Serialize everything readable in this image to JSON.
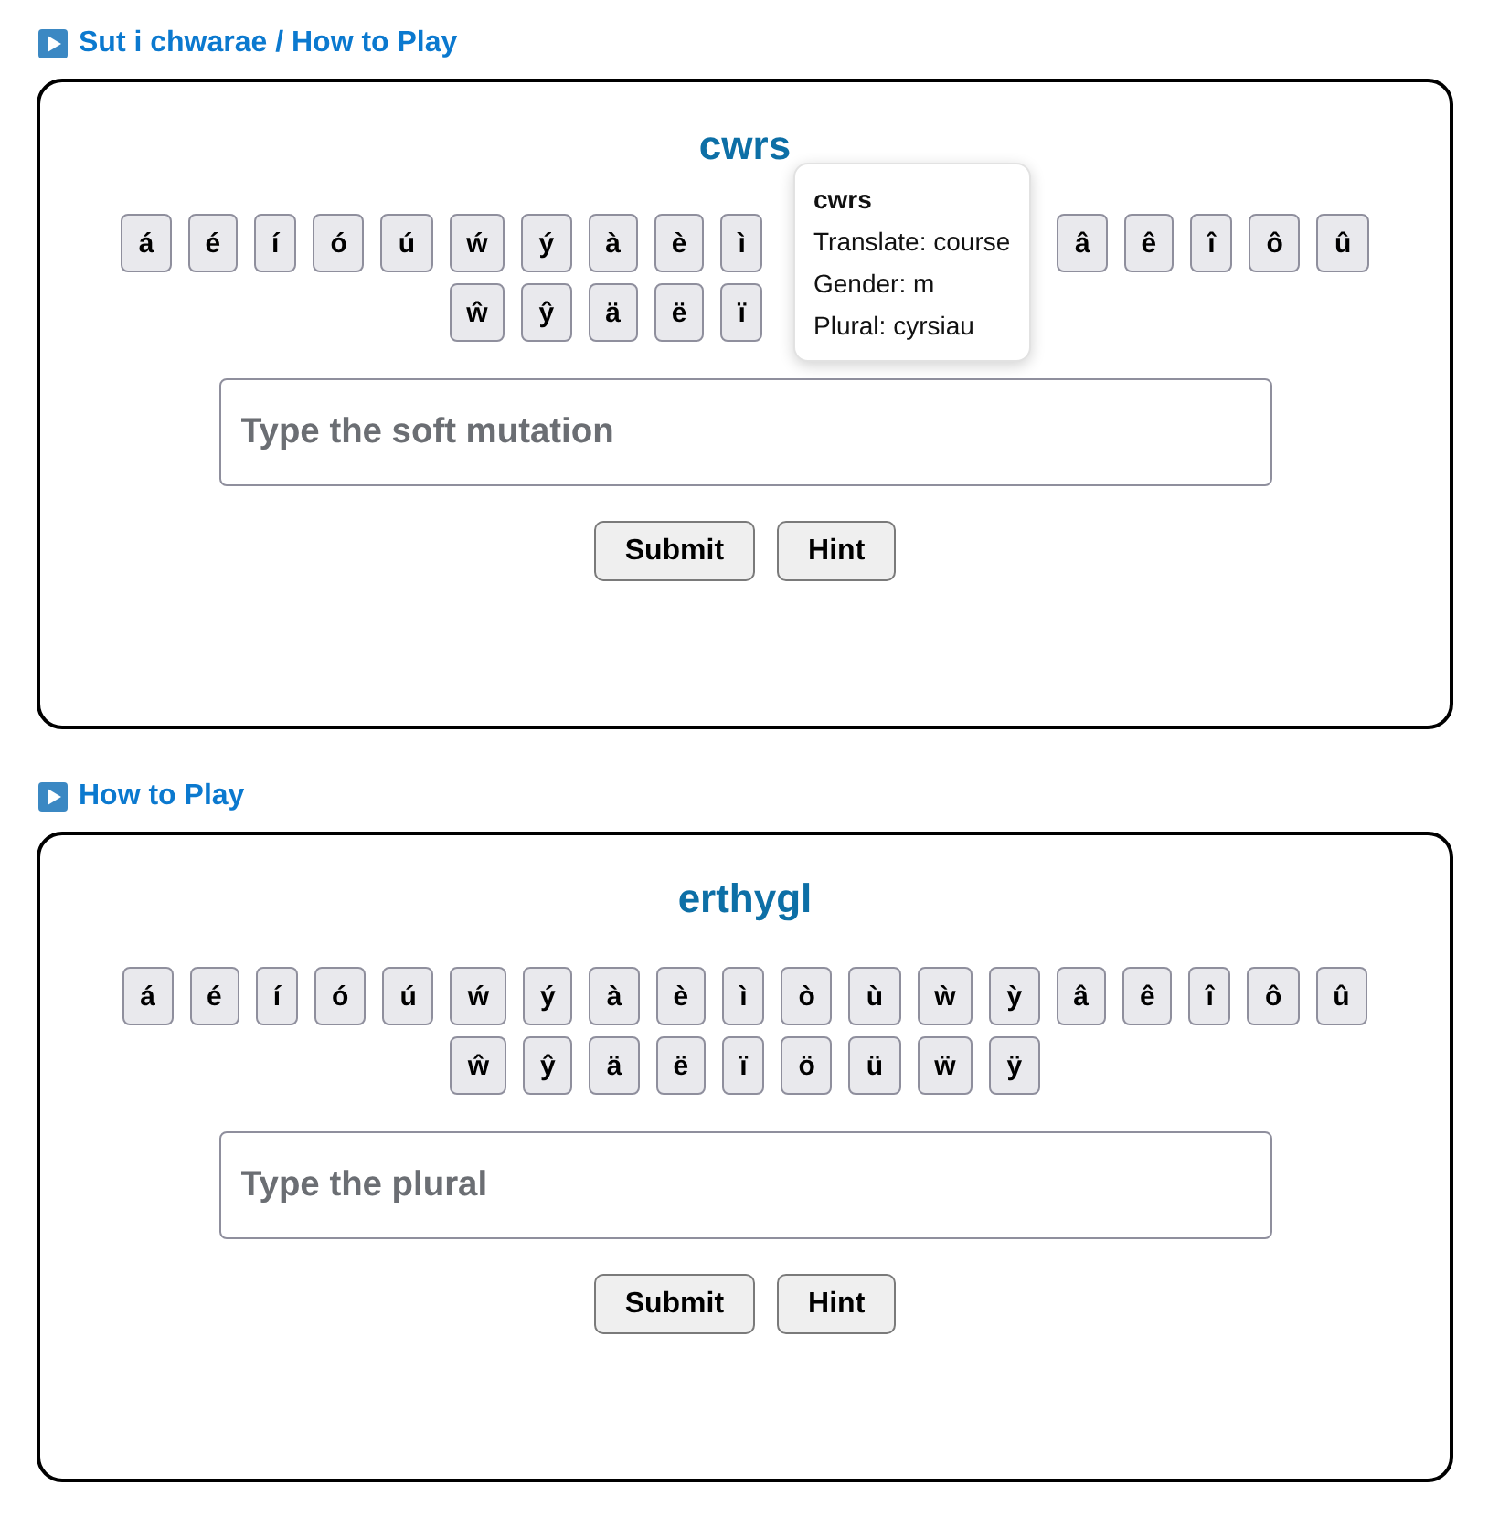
{
  "sections": [
    {
      "heading": "Sut i chwarae / How to Play",
      "card": {
        "word": "cwrs",
        "tooltip": {
          "title": "cwrs",
          "lines": [
            "Translate: course",
            "Gender: m",
            "Plural: cyrsiau"
          ]
        },
        "keyboard": [
          [
            {
              "label": "á",
              "covered": false
            },
            {
              "label": "é",
              "covered": false
            },
            {
              "label": "í",
              "covered": false
            },
            {
              "label": "ó",
              "covered": false
            },
            {
              "label": "ú",
              "covered": false
            },
            {
              "label": "ẃ",
              "covered": false
            },
            {
              "label": "ý",
              "covered": false
            },
            {
              "label": "à",
              "covered": false
            },
            {
              "label": "è",
              "covered": false
            },
            {
              "label": "ì",
              "covered": false
            },
            {
              "covered": true
            },
            {
              "covered": true
            },
            {
              "covered": true
            },
            {
              "covered": true
            },
            {
              "label": "â",
              "covered": false
            },
            {
              "label": "ê",
              "covered": false
            },
            {
              "label": "î",
              "covered": false
            },
            {
              "label": "ô",
              "covered": false
            },
            {
              "label": "û",
              "covered": false
            }
          ],
          [
            {
              "label": "ŵ",
              "covered": false
            },
            {
              "label": "ŷ",
              "covered": false
            },
            {
              "label": "ä",
              "covered": false
            },
            {
              "label": "ë",
              "covered": false
            },
            {
              "label": "ï",
              "covered": false
            },
            {
              "covered": true
            },
            {
              "covered": true
            },
            {
              "covered": true
            },
            {
              "covered": true
            }
          ]
        ],
        "input": {
          "placeholder": "Type the soft mutation"
        },
        "buttons": [
          "Submit",
          "Hint"
        ]
      }
    },
    {
      "heading": "How to Play",
      "card": {
        "word": "erthygl",
        "keyboard": [
          [
            {
              "label": "á",
              "covered": false
            },
            {
              "label": "é",
              "covered": false
            },
            {
              "label": "í",
              "covered": false
            },
            {
              "label": "ó",
              "covered": false
            },
            {
              "label": "ú",
              "covered": false
            },
            {
              "label": "ẃ",
              "covered": false
            },
            {
              "label": "ý",
              "covered": false
            },
            {
              "label": "à",
              "covered": false
            },
            {
              "label": "è",
              "covered": false
            },
            {
              "label": "ì",
              "covered": false
            },
            {
              "label": "ò",
              "covered": false
            },
            {
              "label": "ù",
              "covered": false
            },
            {
              "label": "ẁ",
              "covered": false
            },
            {
              "label": "ỳ",
              "covered": false
            },
            {
              "label": "â",
              "covered": false
            },
            {
              "label": "ê",
              "covered": false
            },
            {
              "label": "î",
              "covered": false
            },
            {
              "label": "ô",
              "covered": false
            },
            {
              "label": "û",
              "covered": false
            }
          ],
          [
            {
              "label": "ŵ",
              "covered": false
            },
            {
              "label": "ŷ",
              "covered": false
            },
            {
              "label": "ä",
              "covered": false
            },
            {
              "label": "ë",
              "covered": false
            },
            {
              "label": "ï",
              "covered": false
            },
            {
              "label": "ö",
              "covered": false
            },
            {
              "label": "ü",
              "covered": false
            },
            {
              "label": "ẅ",
              "covered": false
            },
            {
              "label": "ÿ",
              "covered": false
            }
          ]
        ],
        "input": {
          "placeholder": "Type the plural"
        },
        "buttons": [
          "Submit",
          "Hint"
        ]
      }
    }
  ]
}
